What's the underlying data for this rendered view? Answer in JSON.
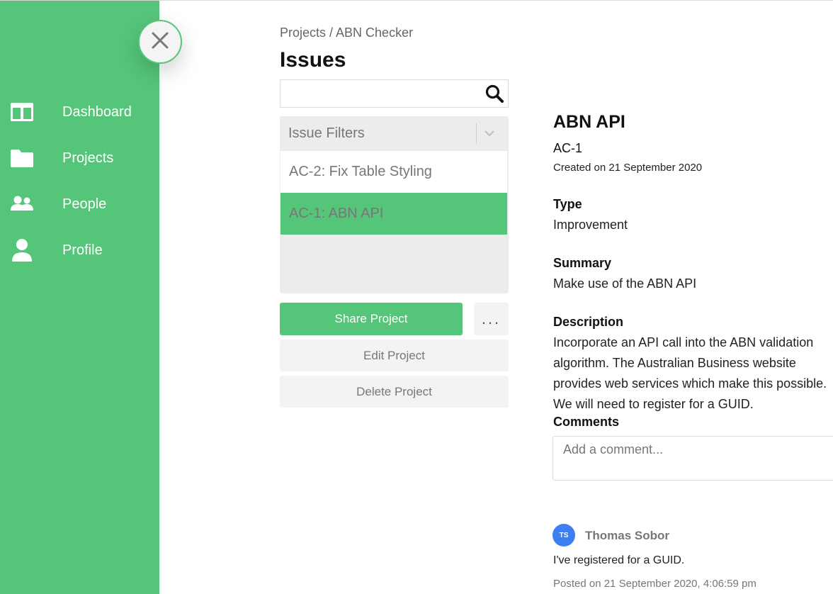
{
  "sidebar": {
    "close_icon": "close-icon",
    "items": [
      {
        "icon": "dashboard-icon",
        "label": "Dashboard"
      },
      {
        "icon": "folder-icon",
        "label": "Projects"
      },
      {
        "icon": "people-icon",
        "label": "People"
      },
      {
        "icon": "user-icon",
        "label": "Profile"
      }
    ]
  },
  "breadcrumb": "Projects / ABN Checker",
  "page_title": "Issues",
  "search": {
    "value": "",
    "placeholder": ""
  },
  "filters": {
    "label": "Issue Filters",
    "issues": [
      {
        "label": "AC-2: Fix Table Styling",
        "selected": false
      },
      {
        "label": "AC-1: ABN API",
        "selected": true
      }
    ]
  },
  "actions": {
    "share": "Share Project",
    "more": "...",
    "edit": "Edit Project",
    "delete": "Delete Project"
  },
  "issue": {
    "title": "ABN API",
    "key": "AC-1",
    "created": "Created on 21 September 2020",
    "type_label": "Type",
    "type_value": "Improvement",
    "summary_label": "Summary",
    "summary_value": "Make use of the ABN API",
    "description_label": "Description",
    "description_value": "Incorporate an API call into the ABN validation algorithm. The Australian Business website provides web services which make this possible. We will need to register for a GUID."
  },
  "comments": {
    "label": "Comments",
    "placeholder": "Add a comment...",
    "items": [
      {
        "initials": "TS",
        "author": "Thomas Sobor",
        "text": "I've registered for a GUID.",
        "posted": "Posted on 21 September 2020, 4:06:59 pm"
      }
    ]
  },
  "colors": {
    "accent": "#55c57a",
    "avatar": "#3d7ff3",
    "panel": "#ececec"
  }
}
